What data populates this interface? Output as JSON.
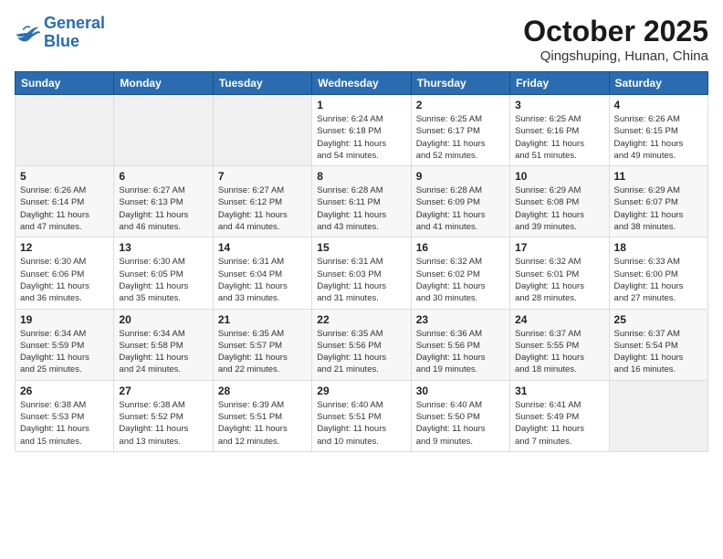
{
  "logo": {
    "line1": "General",
    "line2": "Blue"
  },
  "title": "October 2025",
  "subtitle": "Qingshuping, Hunan, China",
  "weekdays": [
    "Sunday",
    "Monday",
    "Tuesday",
    "Wednesday",
    "Thursday",
    "Friday",
    "Saturday"
  ],
  "weeks": [
    [
      {
        "day": "",
        "info": ""
      },
      {
        "day": "",
        "info": ""
      },
      {
        "day": "",
        "info": ""
      },
      {
        "day": "1",
        "info": "Sunrise: 6:24 AM\nSunset: 6:18 PM\nDaylight: 11 hours\nand 54 minutes."
      },
      {
        "day": "2",
        "info": "Sunrise: 6:25 AM\nSunset: 6:17 PM\nDaylight: 11 hours\nand 52 minutes."
      },
      {
        "day": "3",
        "info": "Sunrise: 6:25 AM\nSunset: 6:16 PM\nDaylight: 11 hours\nand 51 minutes."
      },
      {
        "day": "4",
        "info": "Sunrise: 6:26 AM\nSunset: 6:15 PM\nDaylight: 11 hours\nand 49 minutes."
      }
    ],
    [
      {
        "day": "5",
        "info": "Sunrise: 6:26 AM\nSunset: 6:14 PM\nDaylight: 11 hours\nand 47 minutes."
      },
      {
        "day": "6",
        "info": "Sunrise: 6:27 AM\nSunset: 6:13 PM\nDaylight: 11 hours\nand 46 minutes."
      },
      {
        "day": "7",
        "info": "Sunrise: 6:27 AM\nSunset: 6:12 PM\nDaylight: 11 hours\nand 44 minutes."
      },
      {
        "day": "8",
        "info": "Sunrise: 6:28 AM\nSunset: 6:11 PM\nDaylight: 11 hours\nand 43 minutes."
      },
      {
        "day": "9",
        "info": "Sunrise: 6:28 AM\nSunset: 6:09 PM\nDaylight: 11 hours\nand 41 minutes."
      },
      {
        "day": "10",
        "info": "Sunrise: 6:29 AM\nSunset: 6:08 PM\nDaylight: 11 hours\nand 39 minutes."
      },
      {
        "day": "11",
        "info": "Sunrise: 6:29 AM\nSunset: 6:07 PM\nDaylight: 11 hours\nand 38 minutes."
      }
    ],
    [
      {
        "day": "12",
        "info": "Sunrise: 6:30 AM\nSunset: 6:06 PM\nDaylight: 11 hours\nand 36 minutes."
      },
      {
        "day": "13",
        "info": "Sunrise: 6:30 AM\nSunset: 6:05 PM\nDaylight: 11 hours\nand 35 minutes."
      },
      {
        "day": "14",
        "info": "Sunrise: 6:31 AM\nSunset: 6:04 PM\nDaylight: 11 hours\nand 33 minutes."
      },
      {
        "day": "15",
        "info": "Sunrise: 6:31 AM\nSunset: 6:03 PM\nDaylight: 11 hours\nand 31 minutes."
      },
      {
        "day": "16",
        "info": "Sunrise: 6:32 AM\nSunset: 6:02 PM\nDaylight: 11 hours\nand 30 minutes."
      },
      {
        "day": "17",
        "info": "Sunrise: 6:32 AM\nSunset: 6:01 PM\nDaylight: 11 hours\nand 28 minutes."
      },
      {
        "day": "18",
        "info": "Sunrise: 6:33 AM\nSunset: 6:00 PM\nDaylight: 11 hours\nand 27 minutes."
      }
    ],
    [
      {
        "day": "19",
        "info": "Sunrise: 6:34 AM\nSunset: 5:59 PM\nDaylight: 11 hours\nand 25 minutes."
      },
      {
        "day": "20",
        "info": "Sunrise: 6:34 AM\nSunset: 5:58 PM\nDaylight: 11 hours\nand 24 minutes."
      },
      {
        "day": "21",
        "info": "Sunrise: 6:35 AM\nSunset: 5:57 PM\nDaylight: 11 hours\nand 22 minutes."
      },
      {
        "day": "22",
        "info": "Sunrise: 6:35 AM\nSunset: 5:56 PM\nDaylight: 11 hours\nand 21 minutes."
      },
      {
        "day": "23",
        "info": "Sunrise: 6:36 AM\nSunset: 5:56 PM\nDaylight: 11 hours\nand 19 minutes."
      },
      {
        "day": "24",
        "info": "Sunrise: 6:37 AM\nSunset: 5:55 PM\nDaylight: 11 hours\nand 18 minutes."
      },
      {
        "day": "25",
        "info": "Sunrise: 6:37 AM\nSunset: 5:54 PM\nDaylight: 11 hours\nand 16 minutes."
      }
    ],
    [
      {
        "day": "26",
        "info": "Sunrise: 6:38 AM\nSunset: 5:53 PM\nDaylight: 11 hours\nand 15 minutes."
      },
      {
        "day": "27",
        "info": "Sunrise: 6:38 AM\nSunset: 5:52 PM\nDaylight: 11 hours\nand 13 minutes."
      },
      {
        "day": "28",
        "info": "Sunrise: 6:39 AM\nSunset: 5:51 PM\nDaylight: 11 hours\nand 12 minutes."
      },
      {
        "day": "29",
        "info": "Sunrise: 6:40 AM\nSunset: 5:51 PM\nDaylight: 11 hours\nand 10 minutes."
      },
      {
        "day": "30",
        "info": "Sunrise: 6:40 AM\nSunset: 5:50 PM\nDaylight: 11 hours\nand 9 minutes."
      },
      {
        "day": "31",
        "info": "Sunrise: 6:41 AM\nSunset: 5:49 PM\nDaylight: 11 hours\nand 7 minutes."
      },
      {
        "day": "",
        "info": ""
      }
    ]
  ]
}
